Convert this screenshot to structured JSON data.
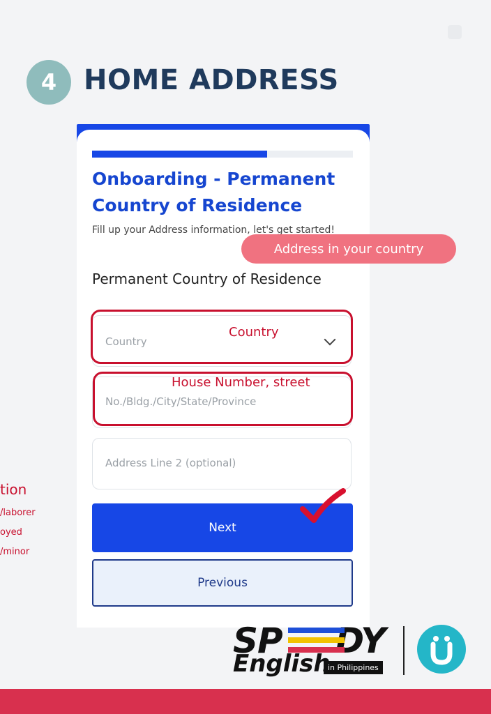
{
  "step": {
    "number": "4",
    "title": "HOME ADDRESS"
  },
  "form": {
    "progress": 0.67,
    "title": "Onboarding - Permanent Country of Residence",
    "subtitle": "Fill up your Address information, let's get started!",
    "section_title": "Permanent Country of Residence",
    "country_field": {
      "placeholder": "Country"
    },
    "address1_field": {
      "placeholder": "No./Bldg./City/State/Province"
    },
    "address2_field": {
      "placeholder": "Address Line 2 (optional)"
    },
    "next_label": "Next",
    "previous_label": "Previous"
  },
  "annotations": {
    "pill": "Address in your country",
    "country_label": "Country",
    "house_label": "House Number, street"
  },
  "left_notes": {
    "heading": "tion",
    "items": [
      "/laborer",
      "oyed",
      "/minor"
    ]
  },
  "brand": {
    "speedy": "SP",
    "speedy_end": "DY",
    "english": "English",
    "badge": "in Philippines"
  },
  "colors": {
    "primary": "#1747e6",
    "accent_red": "#c8102e",
    "pill_pink": "#f07280",
    "heading_navy": "#1f3a5c",
    "bottom_bar": "#d8304e",
    "logo_teal": "#24b6c8"
  }
}
